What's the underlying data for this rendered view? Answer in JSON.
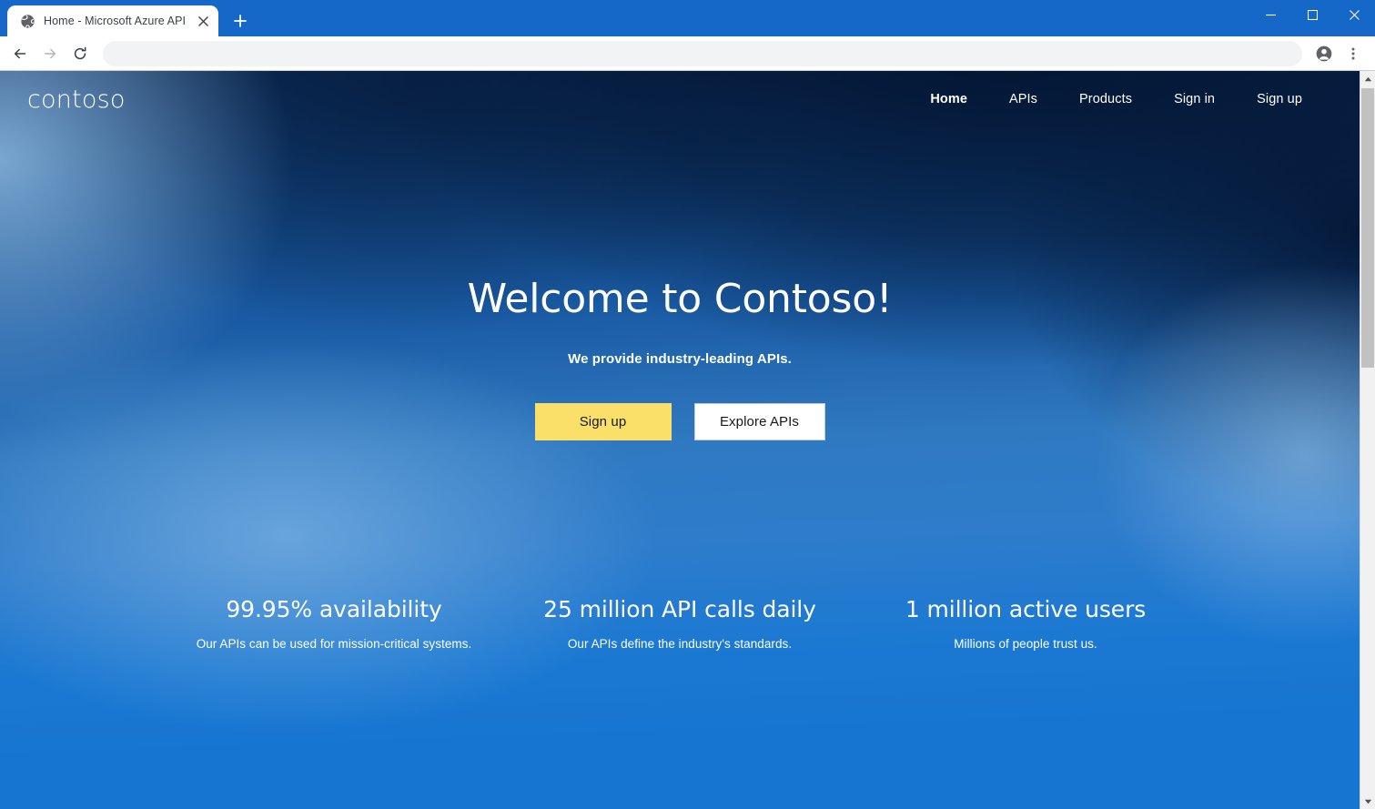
{
  "browser": {
    "tab": {
      "title": "Home - Microsoft Azure API Man",
      "favicon_icon": "globe-icon",
      "close_icon": "close-icon"
    },
    "new_tab_icon": "plus-icon",
    "window_controls": {
      "minimize_icon": "minimize-icon",
      "maximize_icon": "maximize-icon",
      "close_icon": "close-icon"
    },
    "toolbar": {
      "back_icon": "back-arrow-icon",
      "forward_icon": "forward-arrow-icon",
      "reload_icon": "reload-icon",
      "address_value": "",
      "address_placeholder": "",
      "profile_icon": "account-avatar-icon",
      "menu_icon": "three-dot-menu-icon"
    }
  },
  "site": {
    "logo": "contoso",
    "nav": [
      {
        "label": "Home",
        "active": true
      },
      {
        "label": "APIs",
        "active": false
      },
      {
        "label": "Products",
        "active": false
      },
      {
        "label": "Sign in",
        "active": false
      },
      {
        "label": "Sign up",
        "active": false
      }
    ]
  },
  "hero": {
    "title": "Welcome to Contoso!",
    "subtitle": "We provide industry-leading APIs.",
    "primary_button": "Sign up",
    "secondary_button": "Explore APIs"
  },
  "stats": [
    {
      "value": "99.95% availability",
      "description": "Our APIs can be used for mission-critical systems."
    },
    {
      "value": "25 million API calls daily",
      "description": "Our APIs define the industry's standards."
    },
    {
      "value": "1 million active users",
      "description": "Millions of people trust us."
    }
  ],
  "colors": {
    "accent_yellow": "#fadf68",
    "brand_blue": "#1675d1",
    "header_navy": "#0b2a55",
    "browser_blue": "#1567c8"
  },
  "scrollbar": {
    "up_arrow_icon": "caret-up-icon",
    "down_arrow_icon": "caret-down-icon",
    "thumb_position": "top"
  }
}
